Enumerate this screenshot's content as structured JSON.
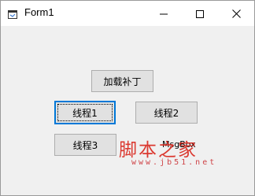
{
  "window": {
    "title": "Form1",
    "minimize_icon": "minimize-icon",
    "maximize_icon": "maximize-icon",
    "close_icon": "close-icon"
  },
  "buttons": {
    "load_patch": "加载补丁",
    "thread1": "线程1",
    "thread2": "线程2",
    "thread3": "线程3"
  },
  "label": {
    "text": "MsgBox"
  },
  "watermark": {
    "text": "脚本之家",
    "url": "www.jb51.net"
  }
}
